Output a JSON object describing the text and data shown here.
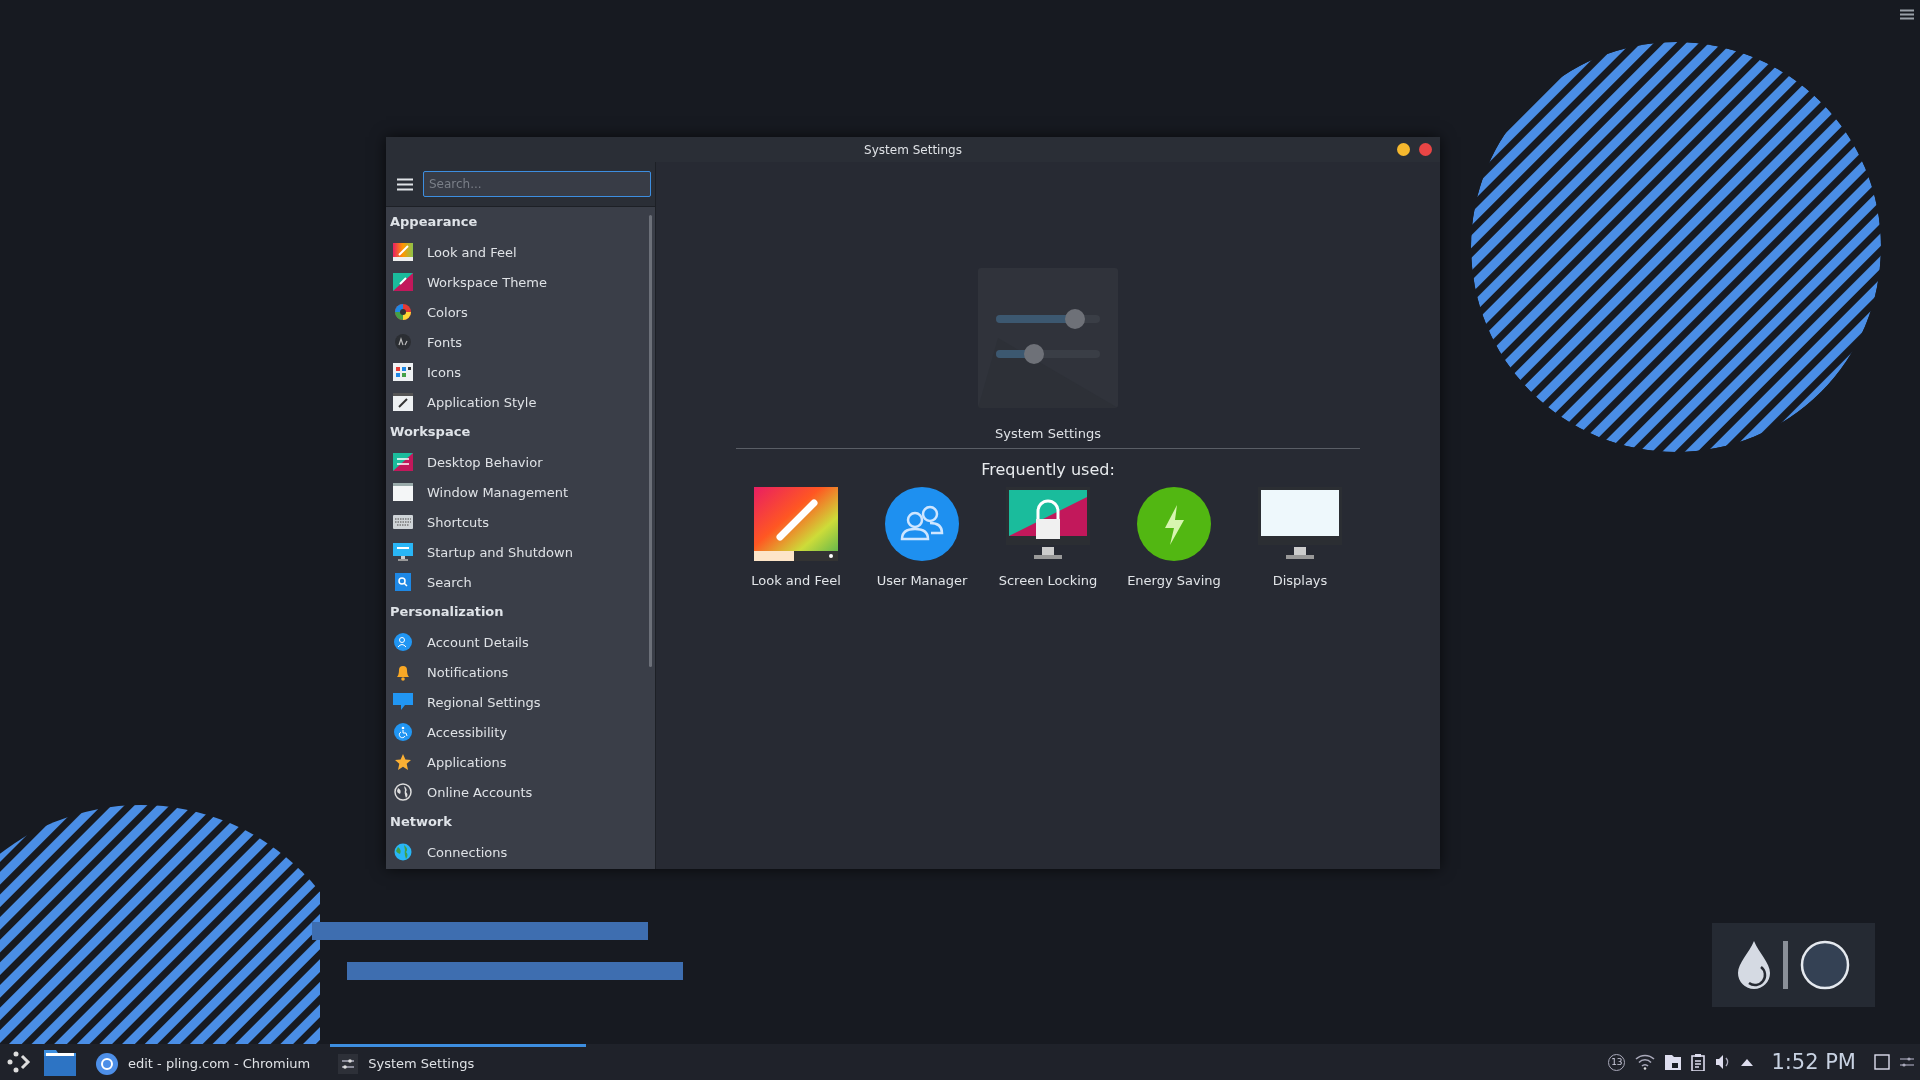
{
  "window": {
    "title": "System Settings"
  },
  "sidebar": {
    "search": {
      "placeholder": "Search..."
    },
    "groups": [
      {
        "title": "Appearance",
        "items": [
          {
            "label": "Look and Feel"
          },
          {
            "label": "Workspace Theme"
          },
          {
            "label": "Colors"
          },
          {
            "label": "Fonts"
          },
          {
            "label": "Icons"
          },
          {
            "label": "Application Style"
          }
        ]
      },
      {
        "title": "Workspace",
        "items": [
          {
            "label": "Desktop Behavior"
          },
          {
            "label": "Window Management"
          },
          {
            "label": "Shortcuts"
          },
          {
            "label": "Startup and Shutdown"
          },
          {
            "label": "Search"
          }
        ]
      },
      {
        "title": "Personalization",
        "items": [
          {
            "label": "Account Details"
          },
          {
            "label": "Notifications"
          },
          {
            "label": "Regional Settings"
          },
          {
            "label": "Accessibility"
          },
          {
            "label": "Applications"
          },
          {
            "label": "Online Accounts"
          }
        ]
      },
      {
        "title": "Network",
        "items": [
          {
            "label": "Connections"
          }
        ]
      }
    ]
  },
  "content": {
    "hero_label": "System Settings",
    "frequent_title": "Frequently used:",
    "frequent": [
      {
        "label": "Look and Feel"
      },
      {
        "label": "User Manager"
      },
      {
        "label": "Screen Locking"
      },
      {
        "label": "Energy Saving"
      },
      {
        "label": "Displays"
      }
    ]
  },
  "taskbar": {
    "tasks": [
      {
        "label": "edit - pling.com - Chromium",
        "selected": false
      },
      {
        "label": "System Settings",
        "selected": true
      }
    ],
    "notification_count": "13",
    "clock": "1:52 PM"
  }
}
